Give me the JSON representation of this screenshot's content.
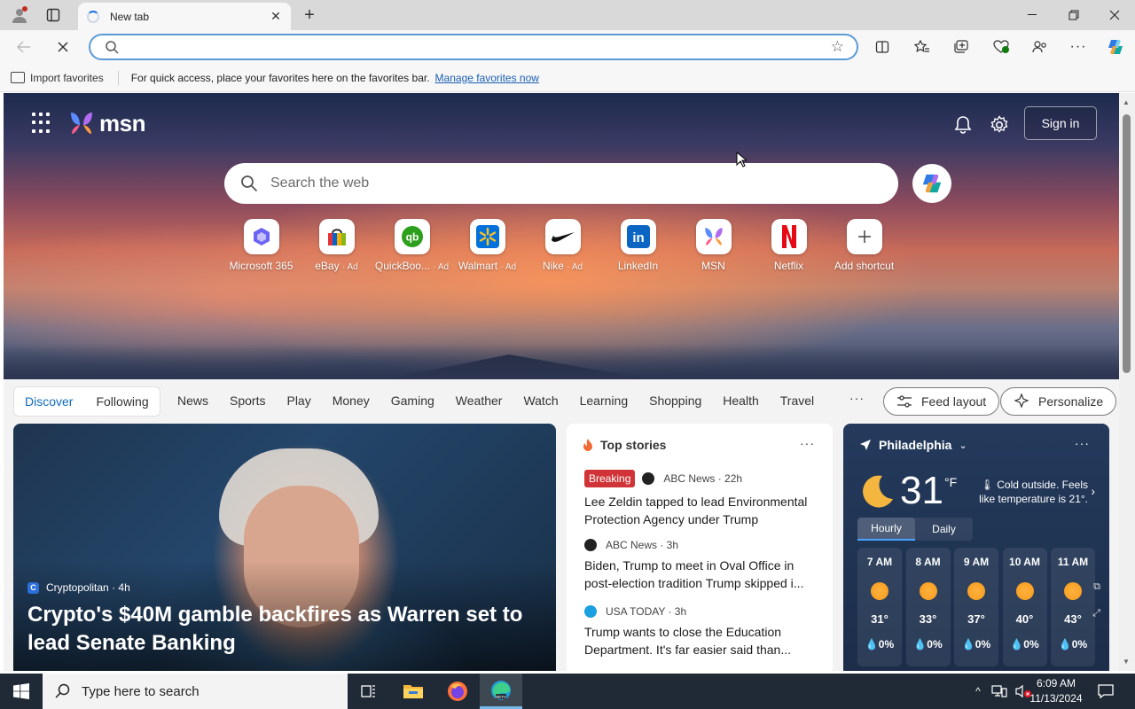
{
  "browser": {
    "tab_title": "New tab",
    "address_value": "",
    "favorites_bar": {
      "import_label": "Import favorites",
      "message": "For quick access, place your favorites here on the favorites bar.",
      "link": "Manage favorites now"
    }
  },
  "msn": {
    "logo_text": "msn",
    "sign_in": "Sign in",
    "search_placeholder": "Search the web",
    "shortcuts": [
      {
        "label": "Microsoft 365",
        "ad": ""
      },
      {
        "label": "eBay",
        "ad": "· Ad"
      },
      {
        "label": "QuickBoo...",
        "ad": "· Ad"
      },
      {
        "label": "Walmart",
        "ad": "· Ad"
      },
      {
        "label": "Nike",
        "ad": "· Ad"
      },
      {
        "label": "LinkedIn",
        "ad": ""
      },
      {
        "label": "MSN",
        "ad": ""
      },
      {
        "label": "Netflix",
        "ad": ""
      },
      {
        "label": "Add shortcut",
        "ad": ""
      }
    ],
    "feed_tabs": {
      "discover": "Discover",
      "following": "Following"
    },
    "categories": [
      "News",
      "Sports",
      "Play",
      "Money",
      "Gaming",
      "Weather",
      "Watch",
      "Learning",
      "Shopping",
      "Health",
      "Travel"
    ],
    "more": "···",
    "feed_layout": "Feed layout",
    "personalize": "Personalize"
  },
  "hero_story": {
    "source": "Cryptopolitan",
    "age": "· 4h",
    "headline": "Crypto's $40M gamble backfires as Warren set to lead Senate Banking"
  },
  "top_stories": {
    "title": "Top stories",
    "items": [
      {
        "badge": "Breaking",
        "source": "ABC News · 22h",
        "headline": "Lee Zeldin tapped to lead Environmental Protection Agency under Trump"
      },
      {
        "badge": "",
        "source": "ABC News · 3h",
        "headline": "Biden, Trump to meet in Oval Office in post-election tradition Trump skipped i..."
      },
      {
        "badge": "",
        "source": "USA TODAY · 3h",
        "headline": "Trump wants to close the Education Department. It's far easier said than..."
      }
    ]
  },
  "weather": {
    "city": "Philadelphia",
    "temp": "31",
    "unit": "°F",
    "desc": "Cold outside. Feels like temperature is 21°.",
    "tabs": [
      "Hourly",
      "Daily"
    ],
    "hours": [
      {
        "time": "7 AM",
        "temp": "31°",
        "precip": "0%"
      },
      {
        "time": "8 AM",
        "temp": "33°",
        "precip": "0%"
      },
      {
        "time": "9 AM",
        "temp": "37°",
        "precip": "0%"
      },
      {
        "time": "10 AM",
        "temp": "40°",
        "precip": "0%"
      },
      {
        "time": "11 AM",
        "temp": "43°",
        "precip": "0%"
      }
    ]
  },
  "taskbar": {
    "search_placeholder": "Type here to search",
    "time": "6:09 AM",
    "date": "11/13/2024"
  }
}
